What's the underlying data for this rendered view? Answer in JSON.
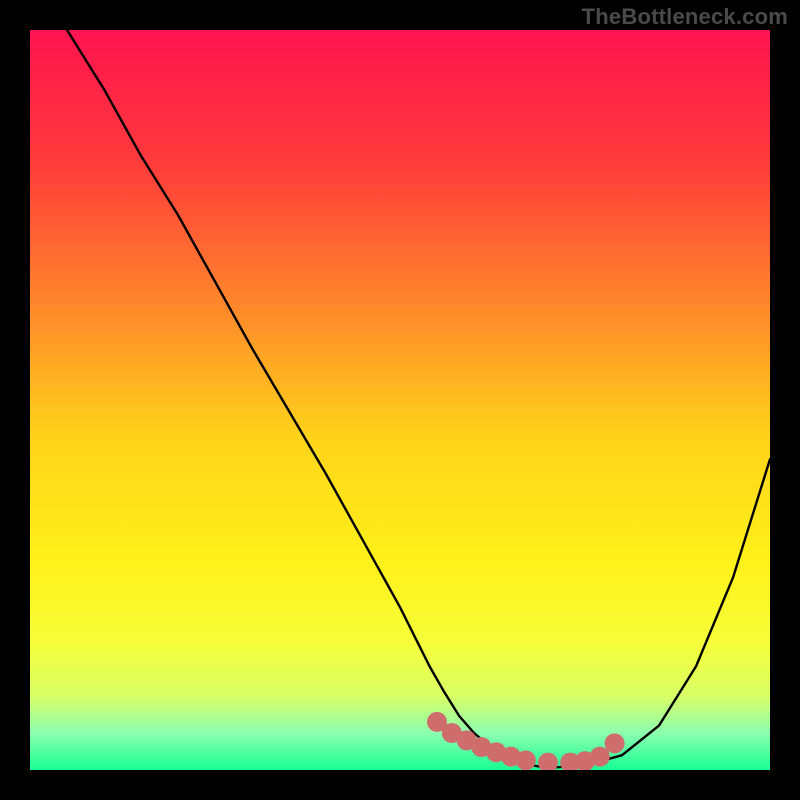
{
  "watermark": {
    "text": "TheBottleneck.com"
  },
  "colors": {
    "gradient_stops": [
      {
        "offset": 0.0,
        "color": "#ff1450"
      },
      {
        "offset": 0.18,
        "color": "#ff3b3b"
      },
      {
        "offset": 0.38,
        "color": "#ff8a2a"
      },
      {
        "offset": 0.55,
        "color": "#ffd31a"
      },
      {
        "offset": 0.72,
        "color": "#fff11a"
      },
      {
        "offset": 0.83,
        "color": "#f6ff3a"
      },
      {
        "offset": 0.9,
        "color": "#d8ff66"
      },
      {
        "offset": 0.95,
        "color": "#8dffb0"
      },
      {
        "offset": 1.0,
        "color": "#17ff92"
      }
    ],
    "curve": "#000000",
    "marker": "#cf6d6d",
    "frame": "#000000"
  },
  "plot": {
    "inner_x": 30,
    "inner_y": 30,
    "inner_w": 740,
    "inner_h": 740,
    "xlim": [
      0,
      100
    ],
    "ylim": [
      0,
      100
    ]
  },
  "chart_data": {
    "type": "line",
    "title": "",
    "xlabel": "",
    "ylabel": "",
    "xlim": [
      0,
      100
    ],
    "ylim": [
      0,
      100
    ],
    "series": [
      {
        "name": "bottleneck-curve",
        "x": [
          5,
          10,
          15,
          20,
          25,
          30,
          35,
          40,
          45,
          50,
          52,
          54,
          56,
          58,
          60,
          62,
          64,
          66,
          68,
          70,
          75,
          80,
          85,
          90,
          95,
          100
        ],
        "y": [
          100,
          92,
          83,
          75,
          66,
          57,
          48.5,
          40,
          31,
          22,
          18,
          14,
          10.5,
          7.3,
          5,
          3.3,
          2.1,
          1.2,
          0.6,
          0.3,
          0.6,
          2,
          6,
          14,
          26,
          42
        ]
      }
    ],
    "markers": {
      "name": "highlight-band",
      "x": [
        55,
        57,
        59,
        61,
        63,
        65,
        67,
        70,
        73,
        75,
        77,
        79
      ],
      "y": [
        6.5,
        5.0,
        4.0,
        3.1,
        2.4,
        1.8,
        1.3,
        1.0,
        1.0,
        1.2,
        1.8,
        3.6
      ]
    }
  }
}
